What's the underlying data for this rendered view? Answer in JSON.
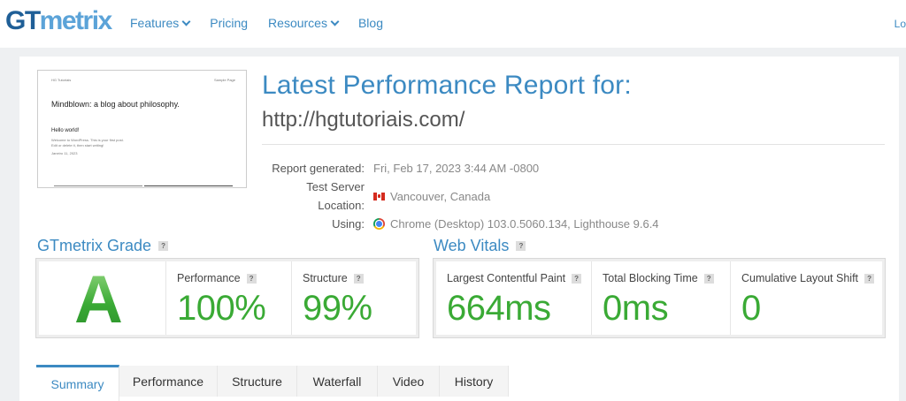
{
  "nav": {
    "logo_a": "GT",
    "logo_b": "metrix",
    "links": [
      {
        "label": "Features",
        "dropdown": true
      },
      {
        "label": "Pricing",
        "dropdown": false
      },
      {
        "label": "Resources",
        "dropdown": true
      },
      {
        "label": "Blog",
        "dropdown": false
      }
    ],
    "login": "Lo"
  },
  "thumbnail": {
    "site_name": "HG Tutoriais",
    "sample_page": "Sample Page",
    "headline": "Mindblown: a blog about philosophy.",
    "post_title": "Hello world!",
    "post_text_1": "Welcome to WordPress. This is your first post.",
    "post_text_2": "Edit or delete it, then start writing!",
    "post_date": "Janeiro 11, 2023"
  },
  "report": {
    "title": "Latest Performance Report for:",
    "url": "http://hgtutoriais.com/",
    "meta": [
      {
        "label": "Report generated:",
        "value": "Fri, Feb 17, 2023 3:44 AM -0800",
        "icon": ""
      },
      {
        "label": "Test Server Location:",
        "value": "Vancouver, Canada",
        "icon": "canada-flag-icon"
      },
      {
        "label": "Using:",
        "value": "Chrome (Desktop) 103.0.5060.134, Lighthouse 9.6.4",
        "icon": "chrome-icon"
      }
    ]
  },
  "grade": {
    "heading": "GTmetrix Grade",
    "help": "?",
    "letter": "A",
    "performance_label": "Performance",
    "performance_value": "100%",
    "structure_label": "Structure",
    "structure_value": "99%"
  },
  "vitals": {
    "heading": "Web Vitals",
    "help": "?",
    "lcp_label": "Largest Contentful Paint",
    "lcp_value": "664ms",
    "tbt_label": "Total Blocking Time",
    "tbt_value": "0ms",
    "cls_label": "Cumulative Layout Shift",
    "cls_value": "0"
  },
  "tabs": [
    "Summary",
    "Performance",
    "Structure",
    "Waterfall",
    "Video",
    "History"
  ],
  "active_tab": "Summary",
  "colors": {
    "brand_blue": "#3c8ac2",
    "grade_green": "#3aaa35"
  }
}
